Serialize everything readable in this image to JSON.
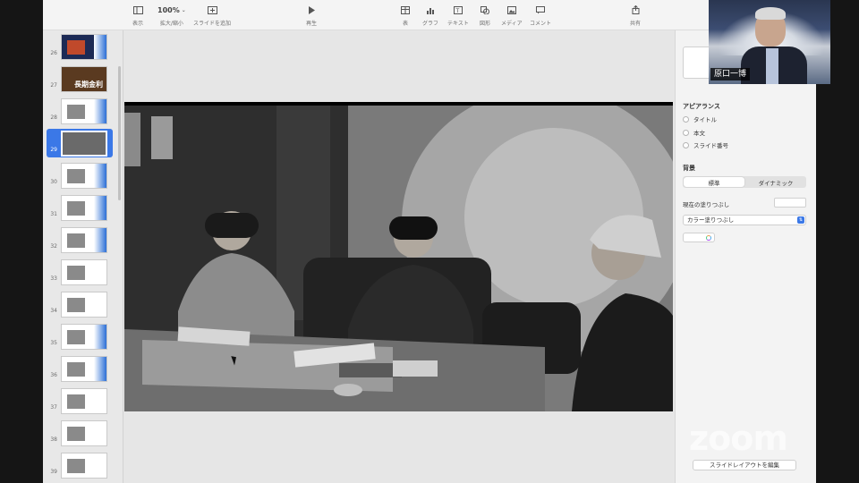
{
  "toolbar": {
    "view_label": "表示",
    "zoom_value": "100%",
    "zoom_label": "拡大/縮小",
    "add_slide_label": "スライドを追加",
    "play_label": "再生",
    "table_label": "表",
    "chart_label": "グラフ",
    "text_label": "テキスト",
    "shape_label": "図形",
    "media_label": "メディア",
    "comment_label": "コメント",
    "share_label": "共有"
  },
  "navigator": {
    "slides": [
      {
        "number": "26"
      },
      {
        "number": "27",
        "caption": "長期金利"
      },
      {
        "number": "28"
      },
      {
        "number": "29",
        "selected": true
      },
      {
        "number": "30"
      },
      {
        "number": "31"
      },
      {
        "number": "32"
      },
      {
        "number": "33"
      },
      {
        "number": "34"
      },
      {
        "number": "35"
      },
      {
        "number": "36"
      },
      {
        "number": "37"
      },
      {
        "number": "38"
      },
      {
        "number": "39"
      }
    ]
  },
  "inspector": {
    "appearance_heading": "アピアランス",
    "options": [
      "タイトル",
      "本文",
      "スライド番号"
    ],
    "background_heading": "背景",
    "segment_standard": "標準",
    "segment_dynamic": "ダイナミック",
    "current_fill_label": "現在の塗りつぶし",
    "fill_select_value": "カラー塗りつぶし",
    "edit_layout_button": "スライドレイアウトを編集"
  },
  "video": {
    "participant_name": "原口一博"
  },
  "watermark": "zoom",
  "colors": {
    "selection_blue": "#3b78e7",
    "toolbar_bg": "#f4f4f4",
    "inspector_bg": "#f3f3f3"
  }
}
